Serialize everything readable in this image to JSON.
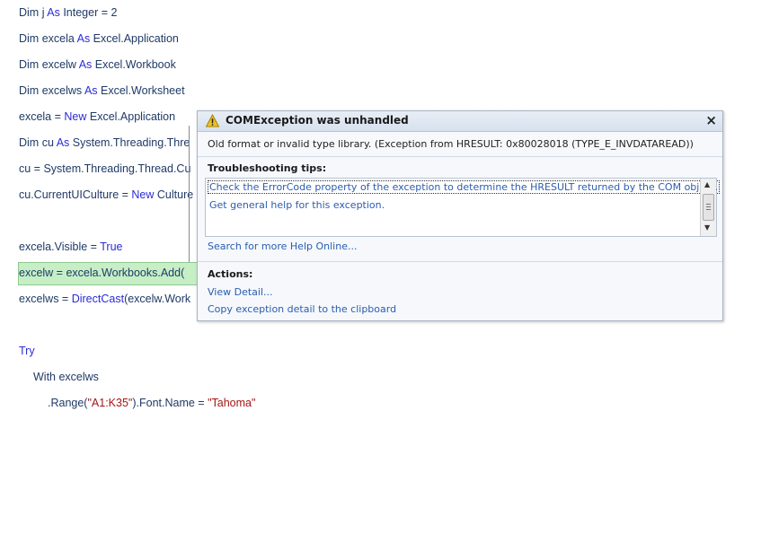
{
  "code": {
    "line1": {
      "p1": "Dim j ",
      "kw1": "As",
      "p2": " Integer = 2"
    },
    "line2": {
      "p1": "Dim excela ",
      "kw1": "As",
      "p2": " Excel.Application"
    },
    "line3": {
      "p1": "Dim excelw ",
      "kw1": "As",
      "p2": " Excel.Workbook"
    },
    "line4": {
      "p1": "Dim excelws ",
      "kw1": "As",
      "p2": " Excel.Worksheet"
    },
    "line5": {
      "p1": "excela = ",
      "kw1": "New",
      "p2": " Excel.Application"
    },
    "line6": {
      "p1": "Dim cu ",
      "kw1": "As",
      "p2": " System.Threading.Thre"
    },
    "line7": {
      "p1": "cu = System.Threading.Thread.Cu"
    },
    "line8": {
      "p1": "cu.CurrentUICulture = ",
      "kw1": "New",
      "p2": " Culture"
    },
    "line9": {
      "p1": "excela.Visible = ",
      "kw1": "True"
    },
    "line10": {
      "p1": "excelw = excela.Workbooks.Add("
    },
    "line11": {
      "p1": "excelws = ",
      "kw1": "DirectCast",
      "p2": "(excelw.Work"
    },
    "line12": {
      "kw1": "Try"
    },
    "line13": {
      "p1": "With excelws"
    },
    "line14": {
      "p1": ".Range(",
      "s1": "\"A1:K35\"",
      "p2": ").Font.Name = ",
      "s2": "\"Tahoma\""
    }
  },
  "exception": {
    "title": "COMException was unhandled",
    "close_symbol": "×",
    "message": "Old format or invalid type library. (Exception from HRESULT: 0x80028018 (TYPE_E_INVDATAREAD))",
    "tips_label": "Troubleshooting tips:",
    "tips": [
      "Check the ErrorCode property of the exception to determine the HRESULT returned by the COM object.",
      "Get general help for this exception."
    ],
    "search_link": "Search for more Help Online...",
    "actions_label": "Actions:",
    "actions": [
      "View Detail...",
      "Copy exception detail to the clipboard"
    ]
  },
  "colors": {
    "keyword": "#2b2bd6",
    "string": "#a31515",
    "identifier": "#1f3a66",
    "highlight": "#c6efc6",
    "link": "#2a5db0"
  }
}
